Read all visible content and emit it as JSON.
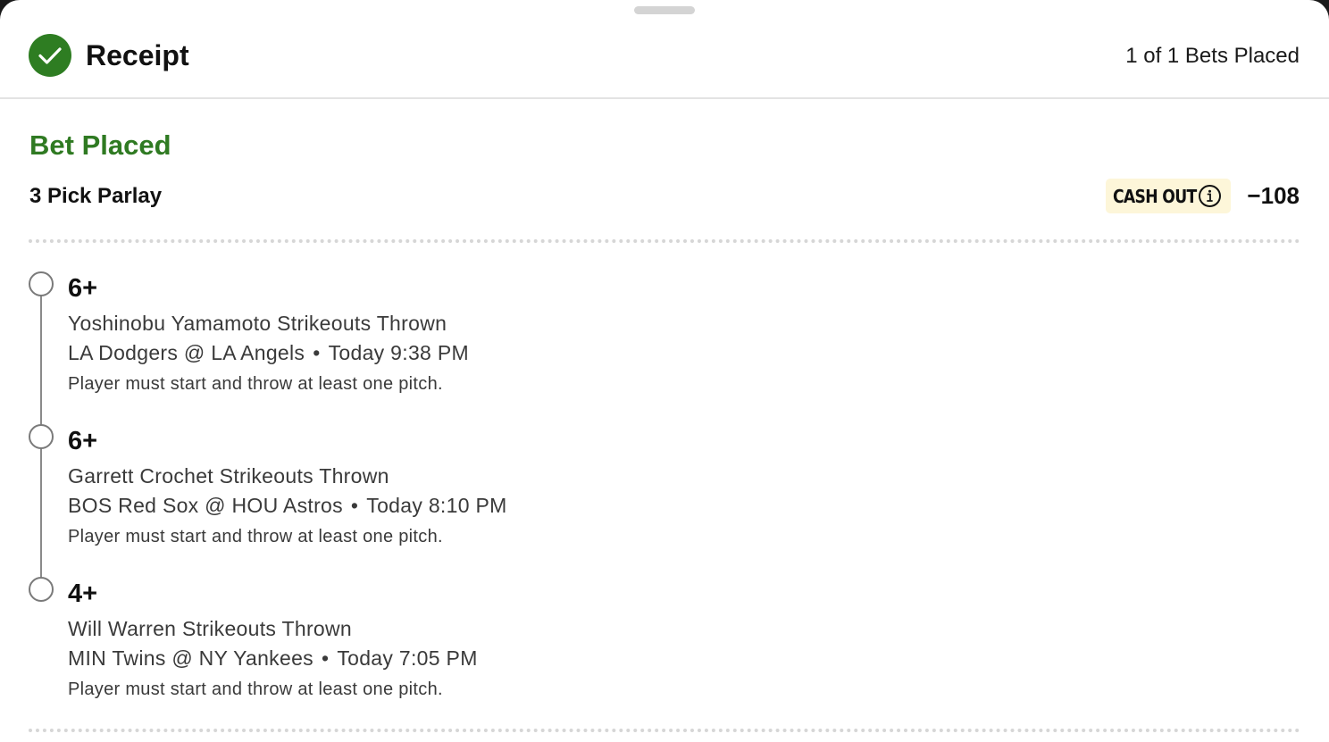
{
  "header": {
    "title": "Receipt",
    "bets_placed": "1 of 1 Bets Placed"
  },
  "bet": {
    "status": "Bet Placed",
    "type": "3 Pick Parlay",
    "cashout_label": "CASH OUT",
    "odds": "−108"
  },
  "legs": [
    {
      "line": "6+",
      "market": "Yoshinobu Yamamoto Strikeouts Thrown",
      "matchup": "LA Dodgers @ LA Angels",
      "separator": "•",
      "time": "Today 9:38 PM",
      "rule": "Player must start and throw at least one pitch."
    },
    {
      "line": "6+",
      "market": "Garrett Crochet Strikeouts Thrown",
      "matchup": "BOS Red Sox @ HOU Astros",
      "separator": "•",
      "time": "Today 8:10 PM",
      "rule": "Player must start and throw at least one pitch."
    },
    {
      "line": "4+",
      "market": "Will Warren Strikeouts Thrown",
      "matchup": "MIN Twins @ NY Yankees",
      "separator": "•",
      "time": "Today 7:05 PM",
      "rule": "Player must start and throw at least one pitch."
    }
  ],
  "icons": {
    "header_status": "checkmark-circle-icon",
    "cashout_info": "info-circle-icon",
    "leg_marker": "hollow-circle-icon"
  },
  "colors": {
    "success_green": "#2e7d22",
    "status_text_green": "#2f7a22",
    "cashout_background": "#fdf6d9"
  }
}
